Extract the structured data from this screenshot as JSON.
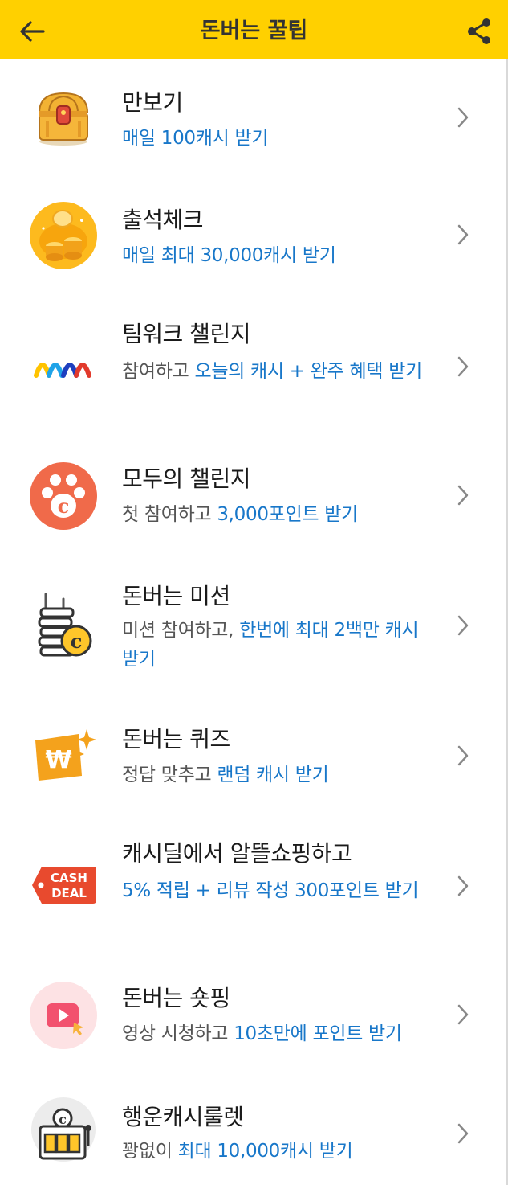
{
  "header": {
    "title": "돈버는 꿀팁",
    "bg_color": "#FFD000"
  },
  "accent_color": "#1877c9",
  "items": [
    {
      "title": "만보기",
      "sub_plain": "",
      "sub_highlight": "매일 100캐시 받기",
      "icon": "treasure-chest-icon"
    },
    {
      "title": "출석체크",
      "sub_plain": "",
      "sub_highlight": "매일 최대 30,000캐시 받기",
      "icon": "gold-coins-icon"
    },
    {
      "title": "팀워크 챌린지",
      "sub_plain": "참여하고 ",
      "sub_highlight": "오늘의 캐시 + 완주 혜택 받기",
      "icon": "teamwork-m-icon"
    },
    {
      "title": "모두의 챌린지",
      "sub_plain": "첫 참여하고 ",
      "sub_highlight": "3,000포인트 받기",
      "icon": "paw-coin-icon"
    },
    {
      "title": "돈버는 미션",
      "sub_plain": "미션 참여하고, ",
      "sub_highlight": "한번에 최대 2백만 캐시 받기",
      "icon": "coin-stack-icon"
    },
    {
      "title": "돈버는 퀴즈",
      "sub_plain": "정답 맞추고 ",
      "sub_highlight": "랜덤 캐시 받기",
      "icon": "won-quiz-icon"
    },
    {
      "title": "캐시딜에서 알뜰쇼핑하고",
      "sub_plain": "",
      "sub_highlight": "5% 적립 + 리뷰 작성 300포인트 받기",
      "icon": "cash-deal-tag-icon",
      "icon_text_1": "CASH",
      "icon_text_2": "DEAL"
    },
    {
      "title": "돈버는 숏핑",
      "sub_plain": "영상 시청하고 ",
      "sub_highlight": "10초만에 포인트 받기",
      "icon": "video-play-icon"
    },
    {
      "title": "행운캐시룰렛",
      "sub_plain": "꽝없이 ",
      "sub_highlight": "최대 10,000캐시 받기",
      "icon": "slot-machine-icon"
    }
  ]
}
